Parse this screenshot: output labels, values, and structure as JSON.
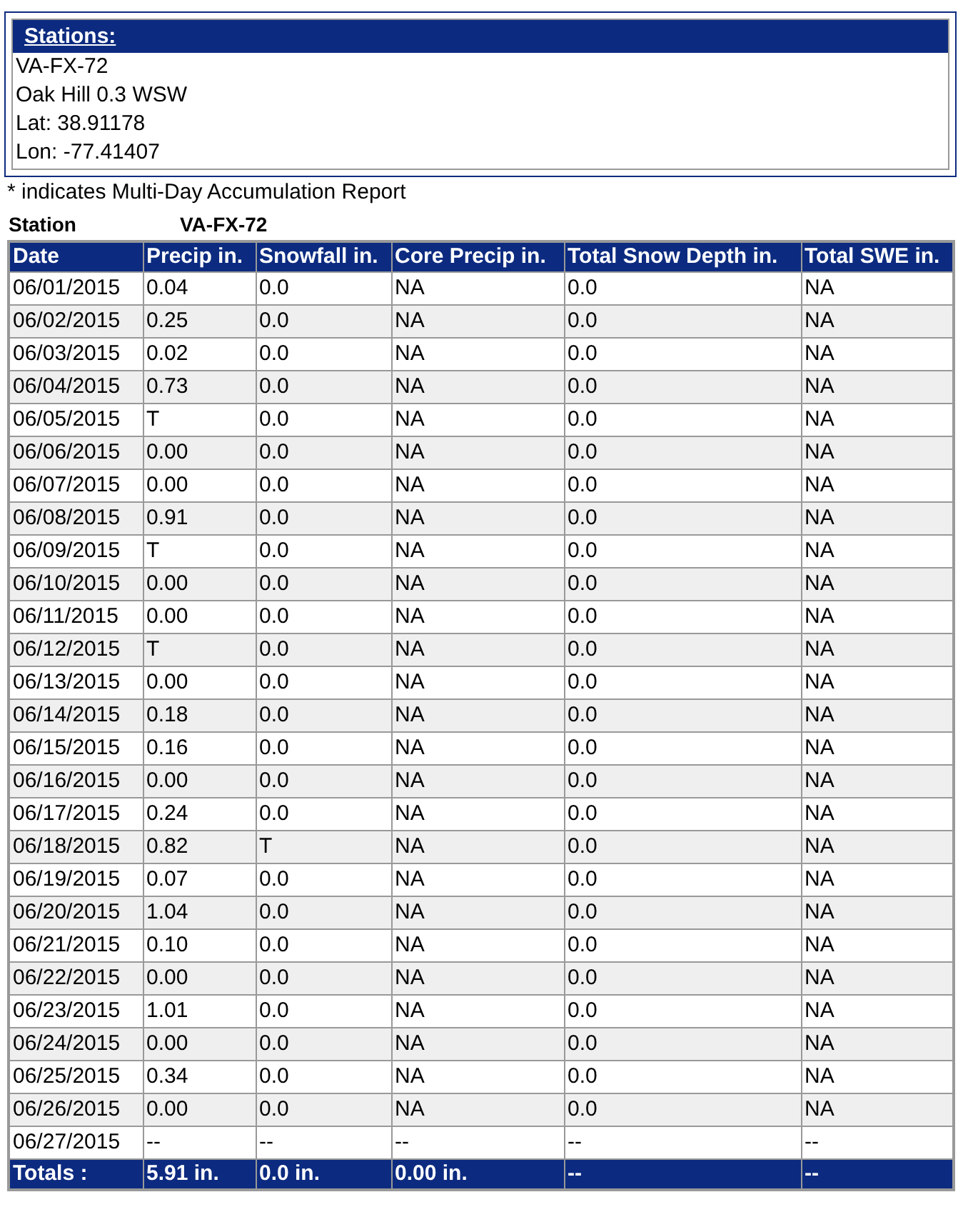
{
  "stations_box": {
    "title": "Stations:",
    "lines": [
      "VA-FX-72",
      "Oak Hill 0.3 WSW",
      "Lat: 38.91178",
      "Lon: -77.41407"
    ]
  },
  "note": "* indicates Multi-Day Accumulation Report",
  "station": {
    "label": "Station",
    "value": "VA-FX-72"
  },
  "table": {
    "columns": [
      "Date",
      "Precip in.",
      "Snowfall in.",
      "Core Precip in.",
      "Total Snow Depth in.",
      "Total SWE in."
    ],
    "rows": [
      [
        "06/01/2015",
        "0.04",
        "0.0",
        "NA",
        "0.0",
        "NA"
      ],
      [
        "06/02/2015",
        "0.25",
        "0.0",
        "NA",
        "0.0",
        "NA"
      ],
      [
        "06/03/2015",
        "0.02",
        "0.0",
        "NA",
        "0.0",
        "NA"
      ],
      [
        "06/04/2015",
        "0.73",
        "0.0",
        "NA",
        "0.0",
        "NA"
      ],
      [
        "06/05/2015",
        "T",
        "0.0",
        "NA",
        "0.0",
        "NA"
      ],
      [
        "06/06/2015",
        "0.00",
        "0.0",
        "NA",
        "0.0",
        "NA"
      ],
      [
        "06/07/2015",
        "0.00",
        "0.0",
        "NA",
        "0.0",
        "NA"
      ],
      [
        "06/08/2015",
        "0.91",
        "0.0",
        "NA",
        "0.0",
        "NA"
      ],
      [
        "06/09/2015",
        "T",
        "0.0",
        "NA",
        "0.0",
        "NA"
      ],
      [
        "06/10/2015",
        "0.00",
        "0.0",
        "NA",
        "0.0",
        "NA"
      ],
      [
        "06/11/2015",
        "0.00",
        "0.0",
        "NA",
        "0.0",
        "NA"
      ],
      [
        "06/12/2015",
        "T",
        "0.0",
        "NA",
        "0.0",
        "NA"
      ],
      [
        "06/13/2015",
        "0.00",
        "0.0",
        "NA",
        "0.0",
        "NA"
      ],
      [
        "06/14/2015",
        "0.18",
        "0.0",
        "NA",
        "0.0",
        "NA"
      ],
      [
        "06/15/2015",
        "0.16",
        "0.0",
        "NA",
        "0.0",
        "NA"
      ],
      [
        "06/16/2015",
        "0.00",
        "0.0",
        "NA",
        "0.0",
        "NA"
      ],
      [
        "06/17/2015",
        "0.24",
        "0.0",
        "NA",
        "0.0",
        "NA"
      ],
      [
        "06/18/2015",
        "0.82",
        "T",
        "NA",
        "0.0",
        "NA"
      ],
      [
        "06/19/2015",
        "0.07",
        "0.0",
        "NA",
        "0.0",
        "NA"
      ],
      [
        "06/20/2015",
        "1.04",
        "0.0",
        "NA",
        "0.0",
        "NA"
      ],
      [
        "06/21/2015",
        "0.10",
        "0.0",
        "NA",
        "0.0",
        "NA"
      ],
      [
        "06/22/2015",
        "0.00",
        "0.0",
        "NA",
        "0.0",
        "NA"
      ],
      [
        "06/23/2015",
        "1.01",
        "0.0",
        "NA",
        "0.0",
        "NA"
      ],
      [
        "06/24/2015",
        "0.00",
        "0.0",
        "NA",
        "0.0",
        "NA"
      ],
      [
        "06/25/2015",
        "0.34",
        "0.0",
        "NA",
        "0.0",
        "NA"
      ],
      [
        "06/26/2015",
        "0.00",
        "0.0",
        "NA",
        "0.0",
        "NA"
      ],
      [
        "06/27/2015",
        "--",
        "--",
        "--",
        "--",
        "--"
      ]
    ],
    "totals": [
      "Totals :",
      "5.91 in.",
      "0.0 in.",
      "0.00 in.",
      "--",
      "--"
    ]
  }
}
